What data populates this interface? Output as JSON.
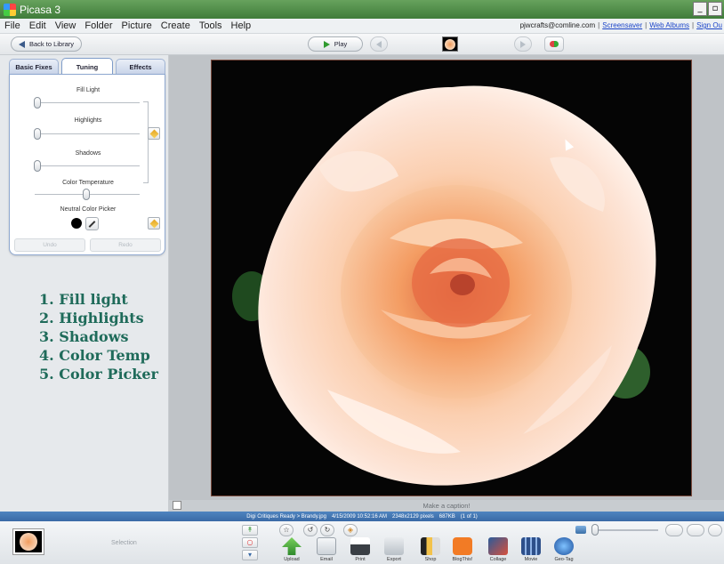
{
  "window": {
    "title": "Picasa 3",
    "buttons": [
      "_",
      "▫"
    ]
  },
  "menu": [
    "File",
    "Edit",
    "View",
    "Folder",
    "Picture",
    "Create",
    "Tools",
    "Help"
  ],
  "account": {
    "email": "pjwcrafts@comline.com",
    "sep": "|",
    "links": [
      "Screensaver",
      "Web Albums",
      "Sign Ou"
    ]
  },
  "toolbar": {
    "back_label": "Back to Library",
    "play_label": "Play"
  },
  "tabs": [
    "Basic Fixes",
    "Tuning",
    "Effects"
  ],
  "tuning": {
    "fill_light": "Fill Light",
    "highlights": "Highlights",
    "shadows": "Shadows",
    "color_temperature": "Color Temperature",
    "neutral_picker": "Neutral Color Picker",
    "undo": "Undo",
    "redo": "Redo",
    "levels": {
      "fill_light": 0,
      "highlights": 0,
      "shadows": 0,
      "color_temperature": 0.5
    }
  },
  "annotation": [
    "1. Fill light",
    "2. Highlights",
    "3. Shadows",
    "4. Color Temp",
    "5. Color Picker"
  ],
  "caption": {
    "placeholder": "Make a caption!"
  },
  "status": {
    "path": "Digi Critiques Ready > Brandy.jpg",
    "date": "4/15/2009 10:52:16 AM",
    "dims": "2348x2129 pixels",
    "size": "687KB",
    "count": "(1 of 1)"
  },
  "tray": {
    "selection": "Selection",
    "actions": [
      "Upload",
      "Email",
      "Print",
      "Export",
      "Shop",
      "BlogThis!",
      "Collage",
      "Movie",
      "Geo-Tag"
    ]
  },
  "colors": {
    "title_bar": "#4f8a46",
    "status_bar": "#4378b4",
    "annotation_text": "#1f6b5a"
  }
}
